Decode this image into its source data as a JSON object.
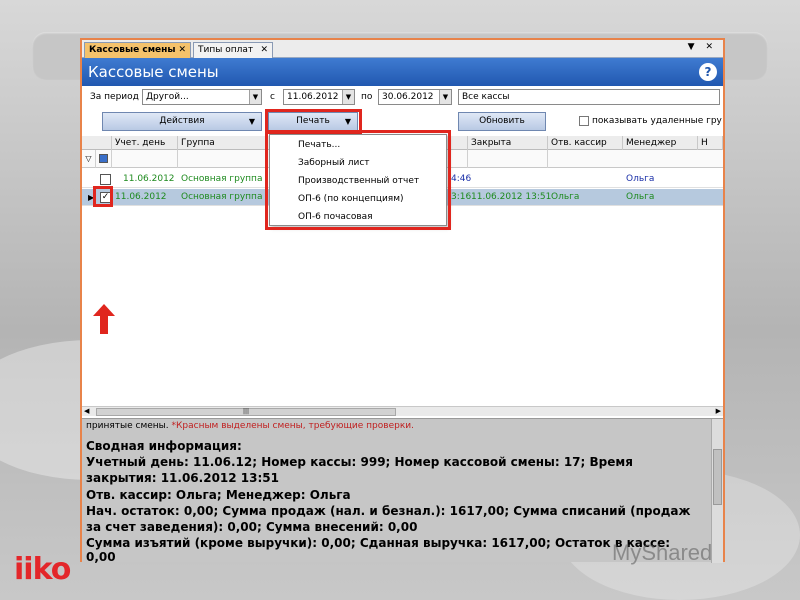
{
  "tabs": [
    {
      "label": "Кассовые смены",
      "close": "✕"
    },
    {
      "label": "Типы оплат",
      "close": "✕"
    }
  ],
  "window_controls": "▼ ✕",
  "title": "Кассовые смены",
  "help_icon": "?",
  "filters": {
    "period_label": "За период",
    "period_value": "Другой...",
    "from_label": "с",
    "from_value": "11.06.2012",
    "to_label": "по",
    "to_value": "30.06.2012",
    "cash_value": "Все кассы"
  },
  "buttons": {
    "actions": "Действия",
    "print": "Печать",
    "refresh": "Обновить",
    "show_deleted": "показывать удаленные групп"
  },
  "columns": [
    "Учет. день",
    "Группа",
    "Закрыта",
    "Отв. кассир",
    "Менеджер",
    "Н"
  ],
  "rows": [
    {
      "day": "11.06.2012",
      "group": "Основная группа",
      "time_tail": "4:46",
      "closed": "",
      "cashier": "",
      "manager": "Ольга"
    },
    {
      "day": "11.06.2012",
      "group": "Основная группа",
      "time_tail": "3:16",
      "closed": "11.06.2012 13:51",
      "cashier": "Ольга",
      "manager": "Ольга",
      "checked": "✓"
    }
  ],
  "print_menu": [
    "Печать...",
    "Заборный лист",
    "Производственный отчет",
    "ОП-6 (по концепциям)",
    "ОП-6 почасовая"
  ],
  "info": {
    "note_prefix": "принятые смены.",
    "note_red": "*Красным выделены смены, требующие проверки.",
    "heading": "Сводная информация:",
    "line1": "Учетный день: 11.06.12; Номер кассы: 999; Номер кассовой смены: 17; Время",
    "line2": "закрытия: 11.06.2012 13:51",
    "line3": "Отв. кассир: Ольга; Менеджер: Ольга",
    "line4": "Нач. остаток: 0,00; Сумма продаж (нал. и безнал.): 1617,00; Сумма списаний (продаж",
    "line5": "за счет заведения): 0,00; Сумма внесений: 0,00",
    "line6": "Сумма изъятий (кроме выручки): 0,00; Сданная выручка: 1617,00; Остаток в кассе:",
    "line7": "0,00"
  },
  "logo": "iiko",
  "watermark": "MyShared",
  "colors": {
    "title_bar": "#2158b0",
    "active_tab": "#f5c26b",
    "highlight": "#e0261e",
    "group_text": "#1e8a1e",
    "manager_text": "#1a2fa8"
  }
}
